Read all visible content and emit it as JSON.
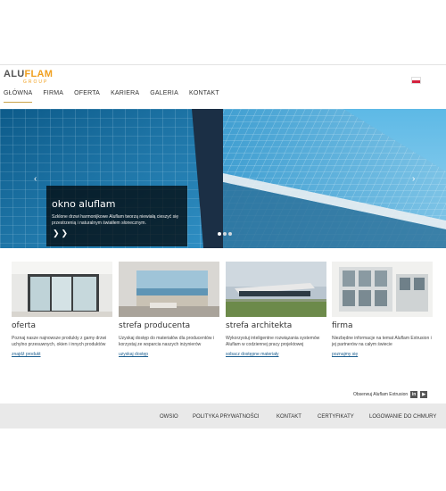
{
  "brand": {
    "main_a": "ALU",
    "main_b": "FLAM",
    "sub": "GROUP"
  },
  "nav": [
    "GŁÓWNA",
    "FIRMA",
    "OFERTA",
    "KARIERA",
    "GALERIA",
    "KONTAKT"
  ],
  "hero": {
    "title": "okno aluflam",
    "text": "Szklone drzwi harmonijkowe Aluflam tworzą niewiałą cieszyć się przestrzenią i naturalnym światłem słonecznym.",
    "arrows": "❯❯",
    "prev": "‹",
    "next": "›"
  },
  "cards": [
    {
      "title": "oferta",
      "text": "Poznaj nasze najnowsze produkty z gamy drzwi uchylno przesuwnych, okien i innych produktów",
      "link": "znajdź produkt"
    },
    {
      "title": "strefa producenta",
      "text": "Uzyskaj dostęp do materiałów dla producentów i korzystaj ze wsparcia naszych inżynierów",
      "link": "uzyskaj dostęp"
    },
    {
      "title": "strefa architekta",
      "text": "Wykorzystuj inteligentne rozwiązania systemów Aluflam w codziennej pracy projektowej",
      "link": "sobacz dostępne materiały"
    },
    {
      "title": "firma",
      "text": "Niezbędne informacje na temat Aluflam Extrusion i jej partnerów na całym świecie",
      "link": "poznajmy się"
    }
  ],
  "follow": {
    "text": "Obserwuj Aluflam Extrusion",
    "linkedin": "in",
    "youtube": "▶"
  },
  "footer": [
    "OWSIO",
    "POLITYKA PRYWATNOŚCI",
    "KONTAKT",
    "CERTYFIKATY",
    "LOGOWANIE DO CHMURY"
  ]
}
